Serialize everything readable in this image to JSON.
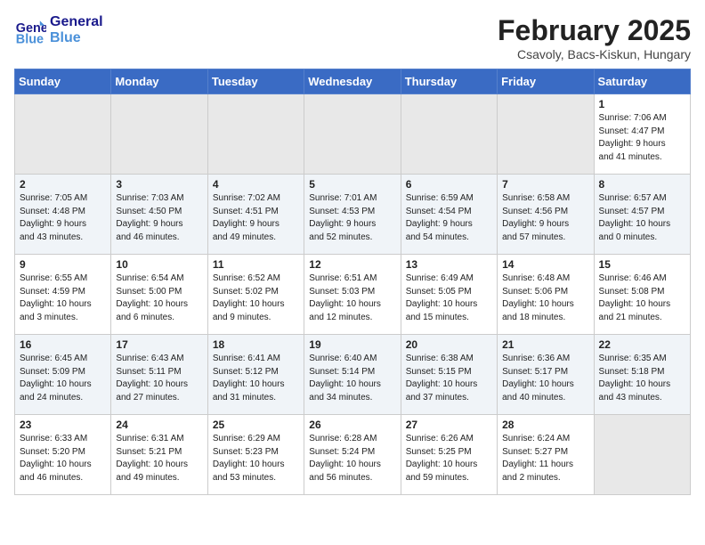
{
  "header": {
    "logo_line1": "General",
    "logo_line2": "Blue",
    "month": "February 2025",
    "location": "Csavoly, Bacs-Kiskun, Hungary"
  },
  "days_of_week": [
    "Sunday",
    "Monday",
    "Tuesday",
    "Wednesday",
    "Thursday",
    "Friday",
    "Saturday"
  ],
  "weeks": [
    [
      {
        "day": "",
        "info": ""
      },
      {
        "day": "",
        "info": ""
      },
      {
        "day": "",
        "info": ""
      },
      {
        "day": "",
        "info": ""
      },
      {
        "day": "",
        "info": ""
      },
      {
        "day": "",
        "info": ""
      },
      {
        "day": "1",
        "info": "Sunrise: 7:06 AM\nSunset: 4:47 PM\nDaylight: 9 hours\nand 41 minutes."
      }
    ],
    [
      {
        "day": "2",
        "info": "Sunrise: 7:05 AM\nSunset: 4:48 PM\nDaylight: 9 hours\nand 43 minutes."
      },
      {
        "day": "3",
        "info": "Sunrise: 7:03 AM\nSunset: 4:50 PM\nDaylight: 9 hours\nand 46 minutes."
      },
      {
        "day": "4",
        "info": "Sunrise: 7:02 AM\nSunset: 4:51 PM\nDaylight: 9 hours\nand 49 minutes."
      },
      {
        "day": "5",
        "info": "Sunrise: 7:01 AM\nSunset: 4:53 PM\nDaylight: 9 hours\nand 52 minutes."
      },
      {
        "day": "6",
        "info": "Sunrise: 6:59 AM\nSunset: 4:54 PM\nDaylight: 9 hours\nand 54 minutes."
      },
      {
        "day": "7",
        "info": "Sunrise: 6:58 AM\nSunset: 4:56 PM\nDaylight: 9 hours\nand 57 minutes."
      },
      {
        "day": "8",
        "info": "Sunrise: 6:57 AM\nSunset: 4:57 PM\nDaylight: 10 hours\nand 0 minutes."
      }
    ],
    [
      {
        "day": "9",
        "info": "Sunrise: 6:55 AM\nSunset: 4:59 PM\nDaylight: 10 hours\nand 3 minutes."
      },
      {
        "day": "10",
        "info": "Sunrise: 6:54 AM\nSunset: 5:00 PM\nDaylight: 10 hours\nand 6 minutes."
      },
      {
        "day": "11",
        "info": "Sunrise: 6:52 AM\nSunset: 5:02 PM\nDaylight: 10 hours\nand 9 minutes."
      },
      {
        "day": "12",
        "info": "Sunrise: 6:51 AM\nSunset: 5:03 PM\nDaylight: 10 hours\nand 12 minutes."
      },
      {
        "day": "13",
        "info": "Sunrise: 6:49 AM\nSunset: 5:05 PM\nDaylight: 10 hours\nand 15 minutes."
      },
      {
        "day": "14",
        "info": "Sunrise: 6:48 AM\nSunset: 5:06 PM\nDaylight: 10 hours\nand 18 minutes."
      },
      {
        "day": "15",
        "info": "Sunrise: 6:46 AM\nSunset: 5:08 PM\nDaylight: 10 hours\nand 21 minutes."
      }
    ],
    [
      {
        "day": "16",
        "info": "Sunrise: 6:45 AM\nSunset: 5:09 PM\nDaylight: 10 hours\nand 24 minutes."
      },
      {
        "day": "17",
        "info": "Sunrise: 6:43 AM\nSunset: 5:11 PM\nDaylight: 10 hours\nand 27 minutes."
      },
      {
        "day": "18",
        "info": "Sunrise: 6:41 AM\nSunset: 5:12 PM\nDaylight: 10 hours\nand 31 minutes."
      },
      {
        "day": "19",
        "info": "Sunrise: 6:40 AM\nSunset: 5:14 PM\nDaylight: 10 hours\nand 34 minutes."
      },
      {
        "day": "20",
        "info": "Sunrise: 6:38 AM\nSunset: 5:15 PM\nDaylight: 10 hours\nand 37 minutes."
      },
      {
        "day": "21",
        "info": "Sunrise: 6:36 AM\nSunset: 5:17 PM\nDaylight: 10 hours\nand 40 minutes."
      },
      {
        "day": "22",
        "info": "Sunrise: 6:35 AM\nSunset: 5:18 PM\nDaylight: 10 hours\nand 43 minutes."
      }
    ],
    [
      {
        "day": "23",
        "info": "Sunrise: 6:33 AM\nSunset: 5:20 PM\nDaylight: 10 hours\nand 46 minutes."
      },
      {
        "day": "24",
        "info": "Sunrise: 6:31 AM\nSunset: 5:21 PM\nDaylight: 10 hours\nand 49 minutes."
      },
      {
        "day": "25",
        "info": "Sunrise: 6:29 AM\nSunset: 5:23 PM\nDaylight: 10 hours\nand 53 minutes."
      },
      {
        "day": "26",
        "info": "Sunrise: 6:28 AM\nSunset: 5:24 PM\nDaylight: 10 hours\nand 56 minutes."
      },
      {
        "day": "27",
        "info": "Sunrise: 6:26 AM\nSunset: 5:25 PM\nDaylight: 10 hours\nand 59 minutes."
      },
      {
        "day": "28",
        "info": "Sunrise: 6:24 AM\nSunset: 5:27 PM\nDaylight: 11 hours\nand 2 minutes."
      },
      {
        "day": "",
        "info": ""
      }
    ]
  ]
}
